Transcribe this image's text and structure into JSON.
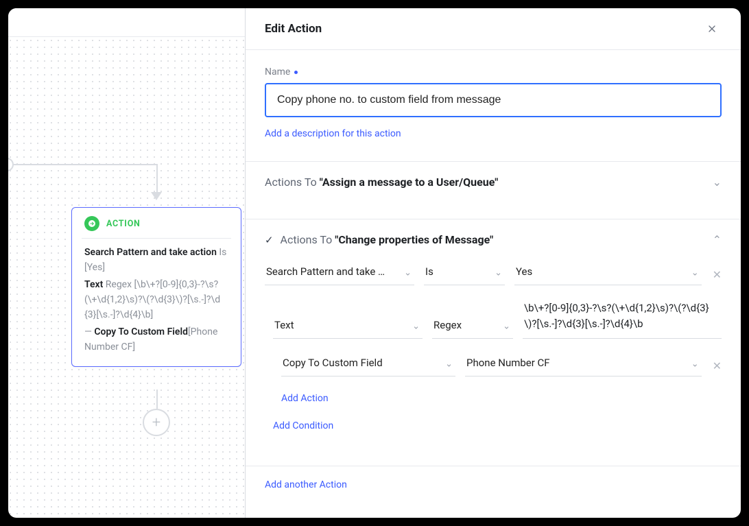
{
  "panel": {
    "title": "Edit Action",
    "name_label": "Name",
    "name_value": "Copy phone no. to custom field from message",
    "add_description": "Add a description for this action"
  },
  "canvas": {
    "action_badge": "ACTION",
    "card": {
      "title_prefix": "Search Pattern and take action",
      "title_cond_label": " Is ",
      "title_cond_value": "[Yes]",
      "text_label": "Text ",
      "text_op": "Regex ",
      "text_regex": "[\\b\\+?[0-9]{0,3}-?\\s?(\\+\\d{1,2}\\s)?\\(?\\d{3}\\)?[\\s.-]?\\d{3}[\\s.-]?\\d{4}\\b]",
      "copy_prefix": "— ",
      "copy_label": "Copy To Custom Field",
      "copy_value": "[Phone Number CF]"
    }
  },
  "sections": {
    "assign": {
      "prefix": "Actions To ",
      "bold": "\"Assign a message to a User/Queue\""
    },
    "change": {
      "prefix": "Actions To ",
      "bold": "\"Change properties of Message\"",
      "row1": {
        "a": "Search Pattern and take …",
        "b": "Is",
        "c": "Yes"
      },
      "row2": {
        "a": "Text",
        "b": "Regex",
        "regex": "\\b\\+?[0-9]{0,3}-?\\s?(\\+\\d{1,2}\\s)?\\(?\\d{3}\\)?[\\s.-]?\\d{3}[\\s.-]?\\d{4}\\b"
      },
      "row3": {
        "a": "Copy To Custom Field",
        "b": "Phone Number CF"
      },
      "add_action": "Add Action",
      "add_condition": "Add Condition",
      "add_another_action": "Add another Action"
    }
  }
}
